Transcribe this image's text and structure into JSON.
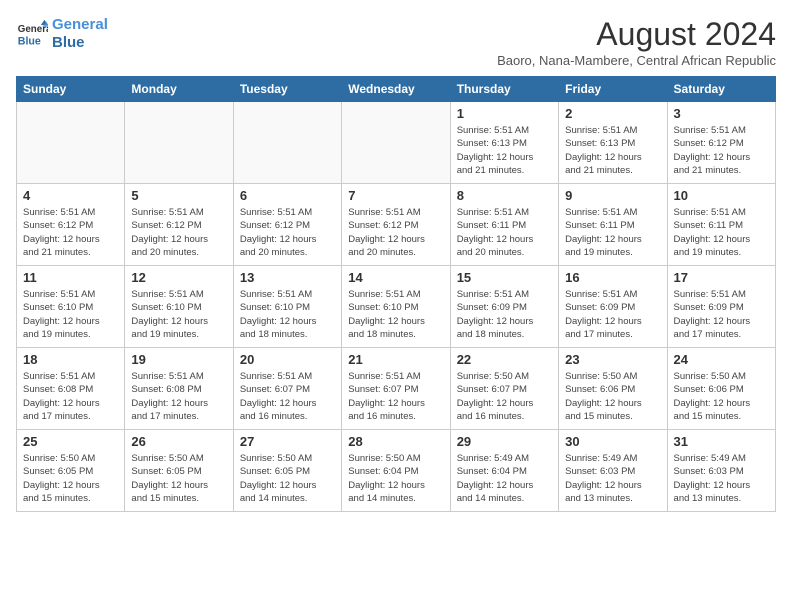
{
  "header": {
    "logo_line1": "General",
    "logo_line2": "Blue",
    "month_year": "August 2024",
    "location": "Baoro, Nana-Mambere, Central African Republic"
  },
  "weekdays": [
    "Sunday",
    "Monday",
    "Tuesday",
    "Wednesday",
    "Thursday",
    "Friday",
    "Saturday"
  ],
  "weeks": [
    [
      {
        "day": "",
        "info": "",
        "empty": true
      },
      {
        "day": "",
        "info": "",
        "empty": true
      },
      {
        "day": "",
        "info": "",
        "empty": true
      },
      {
        "day": "",
        "info": "",
        "empty": true
      },
      {
        "day": "1",
        "info": "Sunrise: 5:51 AM\nSunset: 6:13 PM\nDaylight: 12 hours\nand 21 minutes."
      },
      {
        "day": "2",
        "info": "Sunrise: 5:51 AM\nSunset: 6:13 PM\nDaylight: 12 hours\nand 21 minutes."
      },
      {
        "day": "3",
        "info": "Sunrise: 5:51 AM\nSunset: 6:12 PM\nDaylight: 12 hours\nand 21 minutes."
      }
    ],
    [
      {
        "day": "4",
        "info": "Sunrise: 5:51 AM\nSunset: 6:12 PM\nDaylight: 12 hours\nand 21 minutes."
      },
      {
        "day": "5",
        "info": "Sunrise: 5:51 AM\nSunset: 6:12 PM\nDaylight: 12 hours\nand 20 minutes."
      },
      {
        "day": "6",
        "info": "Sunrise: 5:51 AM\nSunset: 6:12 PM\nDaylight: 12 hours\nand 20 minutes."
      },
      {
        "day": "7",
        "info": "Sunrise: 5:51 AM\nSunset: 6:12 PM\nDaylight: 12 hours\nand 20 minutes."
      },
      {
        "day": "8",
        "info": "Sunrise: 5:51 AM\nSunset: 6:11 PM\nDaylight: 12 hours\nand 20 minutes."
      },
      {
        "day": "9",
        "info": "Sunrise: 5:51 AM\nSunset: 6:11 PM\nDaylight: 12 hours\nand 19 minutes."
      },
      {
        "day": "10",
        "info": "Sunrise: 5:51 AM\nSunset: 6:11 PM\nDaylight: 12 hours\nand 19 minutes."
      }
    ],
    [
      {
        "day": "11",
        "info": "Sunrise: 5:51 AM\nSunset: 6:10 PM\nDaylight: 12 hours\nand 19 minutes."
      },
      {
        "day": "12",
        "info": "Sunrise: 5:51 AM\nSunset: 6:10 PM\nDaylight: 12 hours\nand 19 minutes."
      },
      {
        "day": "13",
        "info": "Sunrise: 5:51 AM\nSunset: 6:10 PM\nDaylight: 12 hours\nand 18 minutes."
      },
      {
        "day": "14",
        "info": "Sunrise: 5:51 AM\nSunset: 6:10 PM\nDaylight: 12 hours\nand 18 minutes."
      },
      {
        "day": "15",
        "info": "Sunrise: 5:51 AM\nSunset: 6:09 PM\nDaylight: 12 hours\nand 18 minutes."
      },
      {
        "day": "16",
        "info": "Sunrise: 5:51 AM\nSunset: 6:09 PM\nDaylight: 12 hours\nand 17 minutes."
      },
      {
        "day": "17",
        "info": "Sunrise: 5:51 AM\nSunset: 6:09 PM\nDaylight: 12 hours\nand 17 minutes."
      }
    ],
    [
      {
        "day": "18",
        "info": "Sunrise: 5:51 AM\nSunset: 6:08 PM\nDaylight: 12 hours\nand 17 minutes."
      },
      {
        "day": "19",
        "info": "Sunrise: 5:51 AM\nSunset: 6:08 PM\nDaylight: 12 hours\nand 17 minutes."
      },
      {
        "day": "20",
        "info": "Sunrise: 5:51 AM\nSunset: 6:07 PM\nDaylight: 12 hours\nand 16 minutes."
      },
      {
        "day": "21",
        "info": "Sunrise: 5:51 AM\nSunset: 6:07 PM\nDaylight: 12 hours\nand 16 minutes."
      },
      {
        "day": "22",
        "info": "Sunrise: 5:50 AM\nSunset: 6:07 PM\nDaylight: 12 hours\nand 16 minutes."
      },
      {
        "day": "23",
        "info": "Sunrise: 5:50 AM\nSunset: 6:06 PM\nDaylight: 12 hours\nand 15 minutes."
      },
      {
        "day": "24",
        "info": "Sunrise: 5:50 AM\nSunset: 6:06 PM\nDaylight: 12 hours\nand 15 minutes."
      }
    ],
    [
      {
        "day": "25",
        "info": "Sunrise: 5:50 AM\nSunset: 6:05 PM\nDaylight: 12 hours\nand 15 minutes."
      },
      {
        "day": "26",
        "info": "Sunrise: 5:50 AM\nSunset: 6:05 PM\nDaylight: 12 hours\nand 15 minutes."
      },
      {
        "day": "27",
        "info": "Sunrise: 5:50 AM\nSunset: 6:05 PM\nDaylight: 12 hours\nand 14 minutes."
      },
      {
        "day": "28",
        "info": "Sunrise: 5:50 AM\nSunset: 6:04 PM\nDaylight: 12 hours\nand 14 minutes."
      },
      {
        "day": "29",
        "info": "Sunrise: 5:49 AM\nSunset: 6:04 PM\nDaylight: 12 hours\nand 14 minutes."
      },
      {
        "day": "30",
        "info": "Sunrise: 5:49 AM\nSunset: 6:03 PM\nDaylight: 12 hours\nand 13 minutes."
      },
      {
        "day": "31",
        "info": "Sunrise: 5:49 AM\nSunset: 6:03 PM\nDaylight: 12 hours\nand 13 minutes."
      }
    ]
  ]
}
